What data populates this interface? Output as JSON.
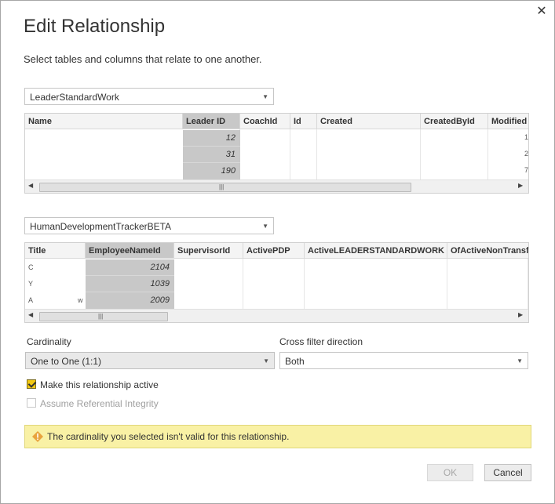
{
  "dialog": {
    "title": "Edit Relationship",
    "subtitle": "Select tables and columns that relate to one another."
  },
  "table1": {
    "selected": "LeaderStandardWork",
    "headers": [
      "Name",
      "Leader ID",
      "CoachId",
      "Id",
      "Created",
      "CreatedById",
      "Modified"
    ],
    "rows": [
      "12",
      "31",
      "190"
    ],
    "edge_glyphs": [
      "1",
      "2",
      "7"
    ]
  },
  "table2": {
    "selected": "HumanDevelopmentTrackerBETA",
    "headers": [
      "Title",
      "EmployeeNameId",
      "SupervisorId",
      "ActivePDP",
      "ActiveLEADERSTANDARDWORK",
      "OfActiveNonTransfo"
    ],
    "rows": [
      "2104",
      "1039",
      "2009"
    ],
    "title_glyphs": [
      "C",
      "Y",
      "A",
      "w"
    ]
  },
  "cardinality": {
    "label": "Cardinality",
    "value": "One to One (1:1)"
  },
  "cross_filter": {
    "label": "Cross filter direction",
    "value": "Both"
  },
  "options": {
    "active_label": "Make this relationship active",
    "active_checked": true,
    "integrity_label": "Assume Referential Integrity",
    "integrity_checked": false
  },
  "warning": {
    "text": "The cardinality you selected isn't valid for this relationship."
  },
  "buttons": {
    "ok": "OK",
    "cancel": "Cancel"
  },
  "glyphs": {
    "close": "✕",
    "caret": "▼",
    "left_arrow": "◀",
    "right_arrow": "▶",
    "grip": "|||"
  },
  "colors": {
    "checkbox_accent": "#f2c811",
    "warning_bg": "#f9f1a5",
    "selected_column": "#c8c8c8"
  }
}
